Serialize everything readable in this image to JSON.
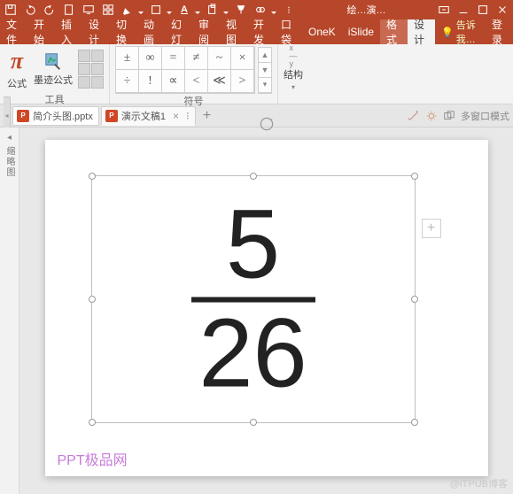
{
  "titlebar": {
    "center1": "绘…",
    "center2": "演…"
  },
  "tabs": {
    "file": "文件",
    "home": "开始",
    "insert": "插入",
    "design_s": "设计",
    "transition": "切换",
    "anim": "动画",
    "slideshow": "幻灯",
    "review": "审阅",
    "view": "视图",
    "dev": "开发",
    "pocket": "口袋",
    "onek": "OneK",
    "islide": "iSlide",
    "format": "格式",
    "design": "设计",
    "tellme": "告诉我…",
    "login": "登录"
  },
  "ribbon": {
    "tools_label": "工具",
    "formula": "公式",
    "ink": "墨迹公式",
    "symbols_label": "符号",
    "structures_label": "结构",
    "sym": [
      "±",
      "∞",
      "=",
      "≠",
      "~",
      "×",
      "÷",
      "!",
      "∝",
      "<",
      "≪",
      ">"
    ]
  },
  "docs": {
    "tab1": "简介头图.pptx",
    "tab2": "演示文稿1",
    "multiwin": "多窗口模式"
  },
  "sidepanel": {
    "label": "缩略图"
  },
  "equation": {
    "numerator": "5",
    "denominator": "26"
  },
  "watermarks": {
    "w1": "PPT极品网",
    "w2": "@ITPUB博客"
  }
}
